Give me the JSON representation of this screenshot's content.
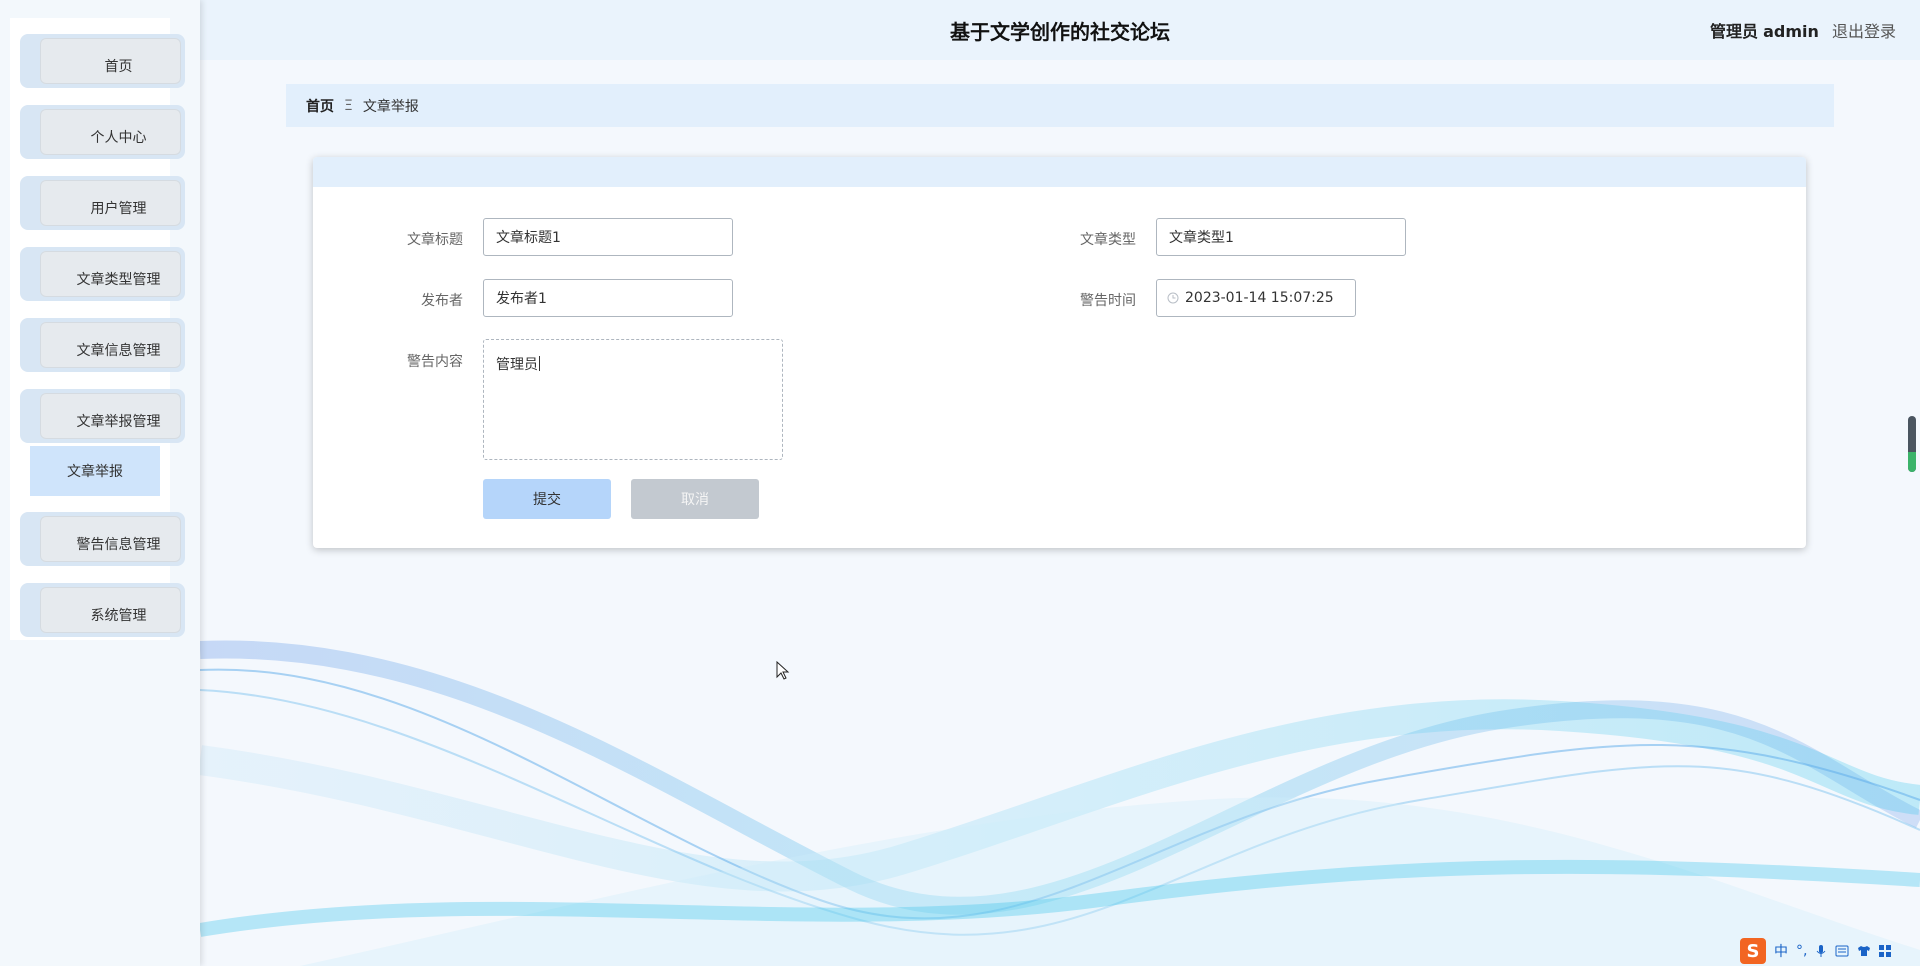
{
  "header": {
    "title": "基于文学创作的社交论坛",
    "user_role": "管理员",
    "user_name": "admin",
    "logout_label": "退出登录"
  },
  "sidebar": {
    "items": [
      {
        "label": "首页"
      },
      {
        "label": "个人中心"
      },
      {
        "label": "用户管理"
      },
      {
        "label": "文章类型管理"
      },
      {
        "label": "文章信息管理"
      },
      {
        "label": "文章举报管理"
      },
      {
        "label": "警告信息管理"
      },
      {
        "label": "系统管理"
      }
    ],
    "active_submenu": "文章举报"
  },
  "breadcrumb": {
    "home": "首页",
    "separator": "Ξ",
    "current": "文章举报"
  },
  "form": {
    "title_label": "文章标题",
    "title_value": "文章标题1",
    "type_label": "文章类型",
    "type_value": "文章类型1",
    "publisher_label": "发布者",
    "publisher_value": "发布者1",
    "warn_time_label": "警告时间",
    "warn_time_value": "2023-01-14 15:07:25",
    "warn_content_label": "警告内容",
    "warn_content_value": "管理员",
    "submit_label": "提交",
    "cancel_label": "取消"
  },
  "ime": {
    "logo": "S",
    "mode": "中",
    "punct": "°,"
  },
  "colors": {
    "accent": "#b5d5fa",
    "header_bg": "#eaf3fc",
    "sidebar_bg": "#f3f8fc"
  }
}
